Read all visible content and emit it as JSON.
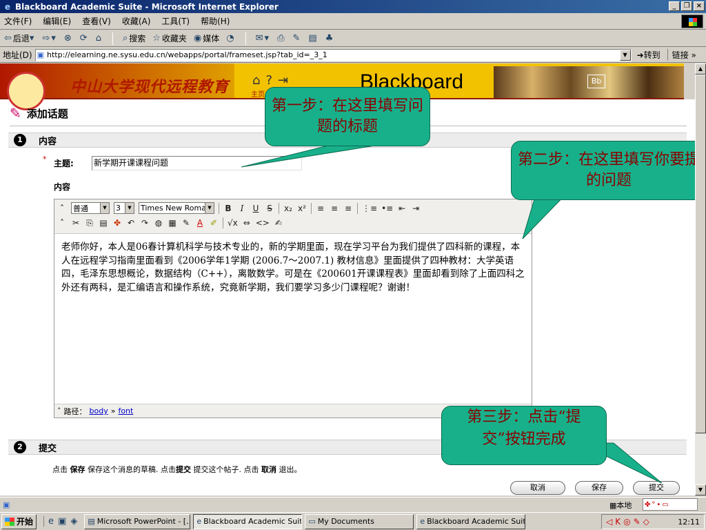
{
  "window": {
    "title": "Blackboard Academic Suite - Microsoft Internet Explorer",
    "controls": [
      "_",
      "❐",
      "×"
    ]
  },
  "menu": [
    "文件(F)",
    "编辑(E)",
    "查看(V)",
    "收藏(A)",
    "工具(T)",
    "帮助(H)"
  ],
  "toolbar": {
    "back": "后退",
    "search": "搜索",
    "favorites": "收藏夹",
    "media": "媒体"
  },
  "address": {
    "label": "地址(D)",
    "url": "http://elearning.ne.sysu.edu.cn/webapps/portal/frameset.jsp?tab_id=_3_1",
    "go": "转到",
    "links": "链接 »"
  },
  "banner": {
    "title": "中山大学现代远程教育",
    "home": "主页",
    "brand": "Blackboard",
    "photo_mark": "Bb"
  },
  "page": {
    "heading": "添加话题",
    "section1": {
      "num": "1",
      "title": "内容"
    },
    "section2": {
      "num": "2",
      "title": "提交"
    },
    "required_mark": "*",
    "subject_label": "主题:",
    "subject_value": "新学期开课课程问题",
    "content_label": "内容"
  },
  "editor": {
    "format": "普通",
    "size": "3",
    "font": "Times New Roman",
    "body": "老师你好，本人是06春计算机科学与技术专业的，新的学期里面，现在学习平台为我们提供了四科新的课程，本人在远程学习指南里面看到《2006学年1学期 (2006.7～2007.1) 教材信息》里面提供了四种教材：大学英语四，毛泽东思想概论，数据结构（C++），离散数学。可是在《200601开课课程表》里面却看到除了上面四科之外还有两科，是汇编语言和操作系统，究竟新学期，我们要学习多少门课程呢？谢谢！",
    "path_label": "路径：",
    "path_body": "body",
    "path_sep": "»",
    "path_font": "font"
  },
  "submit": {
    "instruction_p1": "点击",
    "save_word": "保存",
    "instruction_p2": "保存这个消息的草稿. 点击",
    "submit_word": "提交",
    "instruction_p3": "提交这个帖子. 点击",
    "cancel_word": "取消",
    "instruction_p4": "退出。",
    "cancel_btn": "取消",
    "save_btn": "保存",
    "submit_btn": "提交"
  },
  "callouts": {
    "step1": "第一步：在这里填写问题的标题",
    "step2": "第二步：在这里填写你要提的问题",
    "step3": "第三步：点击“提交”按钮完成"
  },
  "status": {
    "zone": "本地"
  },
  "taskbar": {
    "start": "开始",
    "tasks": [
      "Microsoft PowerPoint - [...",
      "Blackboard Academic Suit...",
      "My Documents",
      "Blackboard Academic Suit..."
    ],
    "clock": "12:11"
  }
}
